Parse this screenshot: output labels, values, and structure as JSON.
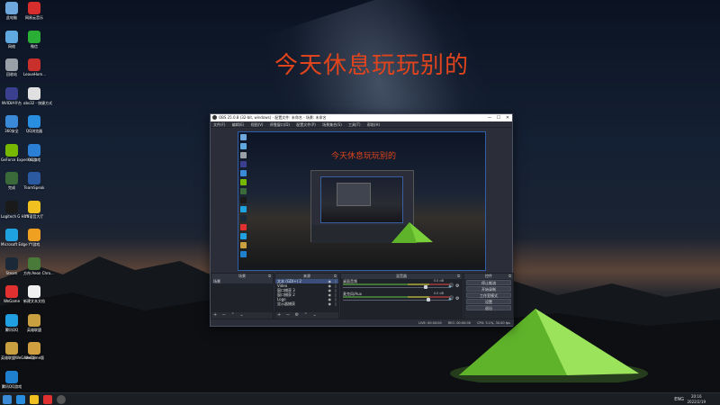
{
  "desktop": {
    "title": "今天休息玩玩别的",
    "icons": [
      {
        "id": "i1",
        "label": "此电脑",
        "color": "#6fa8dc"
      },
      {
        "id": "i2",
        "label": "网易云音乐",
        "color": "#d62d2d"
      },
      {
        "id": "i3",
        "label": "网络",
        "color": "#5fa8e0"
      },
      {
        "id": "i4",
        "label": "微信",
        "color": "#2aae36"
      },
      {
        "id": "i5",
        "label": "回收站",
        "color": "#9aa0a8"
      },
      {
        "id": "i6",
        "label": "LeaveHom...",
        "color": "#c9302c"
      },
      {
        "id": "i7",
        "label": "NVIDIA平台",
        "color": "#3b3f8f"
      },
      {
        "id": "i8",
        "label": "obs32 - 快捷方式",
        "color": "#e0e0e0"
      },
      {
        "id": "i9",
        "label": "360安全",
        "color": "#3b8ad8"
      },
      {
        "id": "i10",
        "label": "QQ浏览器",
        "color": "#2a8ee0"
      },
      {
        "id": "i11",
        "label": "GeForce Experience",
        "color": "#76b900"
      },
      {
        "id": "i12",
        "label": "QQ游戏",
        "color": "#2b7fd4"
      },
      {
        "id": "i13",
        "label": "完成",
        "color": "#3a6a3a"
      },
      {
        "id": "i14",
        "label": "TeamSpeak",
        "color": "#2c5aa0"
      },
      {
        "id": "i15",
        "label": "Logitech G HUB",
        "color": "#1a1a1a"
      },
      {
        "id": "i16",
        "label": "YY语音大厅",
        "color": "#f0c020"
      },
      {
        "id": "i17",
        "label": "Microsoft Edge",
        "color": "#1fa3e0"
      },
      {
        "id": "i18",
        "label": "YY游戏",
        "color": "#f0a020"
      },
      {
        "id": "i19",
        "label": "Steam",
        "color": "#1b2838"
      },
      {
        "id": "i20",
        "label": "方舟:Aeon Chro...",
        "color": "#4a7a3a"
      },
      {
        "id": "i21",
        "label": "WeGame",
        "color": "#e03030"
      },
      {
        "id": "i22",
        "label": "新建文本文档",
        "color": "#f0f0f0"
      },
      {
        "id": "i23",
        "label": "腾讯QQ",
        "color": "#20a0e0"
      },
      {
        "id": "i24",
        "label": "英雄联盟",
        "color": "#c9a040"
      },
      {
        "id": "i25",
        "label": "英雄联盟WeGame版",
        "color": "#c9a040"
      },
      {
        "id": "i26",
        "label": "WeGame版",
        "color": "#d0a040"
      },
      {
        "id": "i27",
        "label": "腾讯QQ游戏",
        "color": "#2080d0"
      }
    ]
  },
  "taskbar": {
    "lang": "ENG",
    "time": "20:16",
    "date": "2022/2/19"
  },
  "obs": {
    "title": "OBS 25.0.8 (32-bit, windows) - 配置文件: 未命名 - 场景: 未命名",
    "min": "—",
    "max": "☐",
    "close": "✕",
    "menu": [
      "文件(F)",
      "编辑(E)",
      "视图(V)",
      "停靠窗口(D)",
      "配置文件(P)",
      "场景集合(S)",
      "工具(T)",
      "帮助(H)"
    ],
    "preview_title": "今天休息玩玩别的",
    "docks": {
      "scenes": {
        "title": "场景",
        "items": [
          "场景"
        ]
      },
      "sources": {
        "title": "来源",
        "items": [
          "文本 (GDI+) 2",
          "Video",
          "窗口捕获 3",
          "窗口捕获 2",
          "Logo",
          "显示器捕获"
        ]
      },
      "mixer": {
        "title": "混音器",
        "rows": [
          {
            "label": "桌面音频",
            "db": "0.0 dB",
            "level": 0.78
          },
          {
            "label": "麦克风/Aux",
            "db": "0.0 dB",
            "level": 0.8
          }
        ]
      },
      "controls": {
        "title": "控件",
        "buttons": [
          "停止推流",
          "开始录制",
          "工作室模式",
          "设置",
          "退出"
        ],
        "half_buttons": [
          "推流",
          "暂停推流"
        ]
      }
    },
    "status": [
      "LIVE: 00:00:00",
      "REC: 00:00:00",
      "CPU: 5.1%, 30.00 fps"
    ]
  }
}
